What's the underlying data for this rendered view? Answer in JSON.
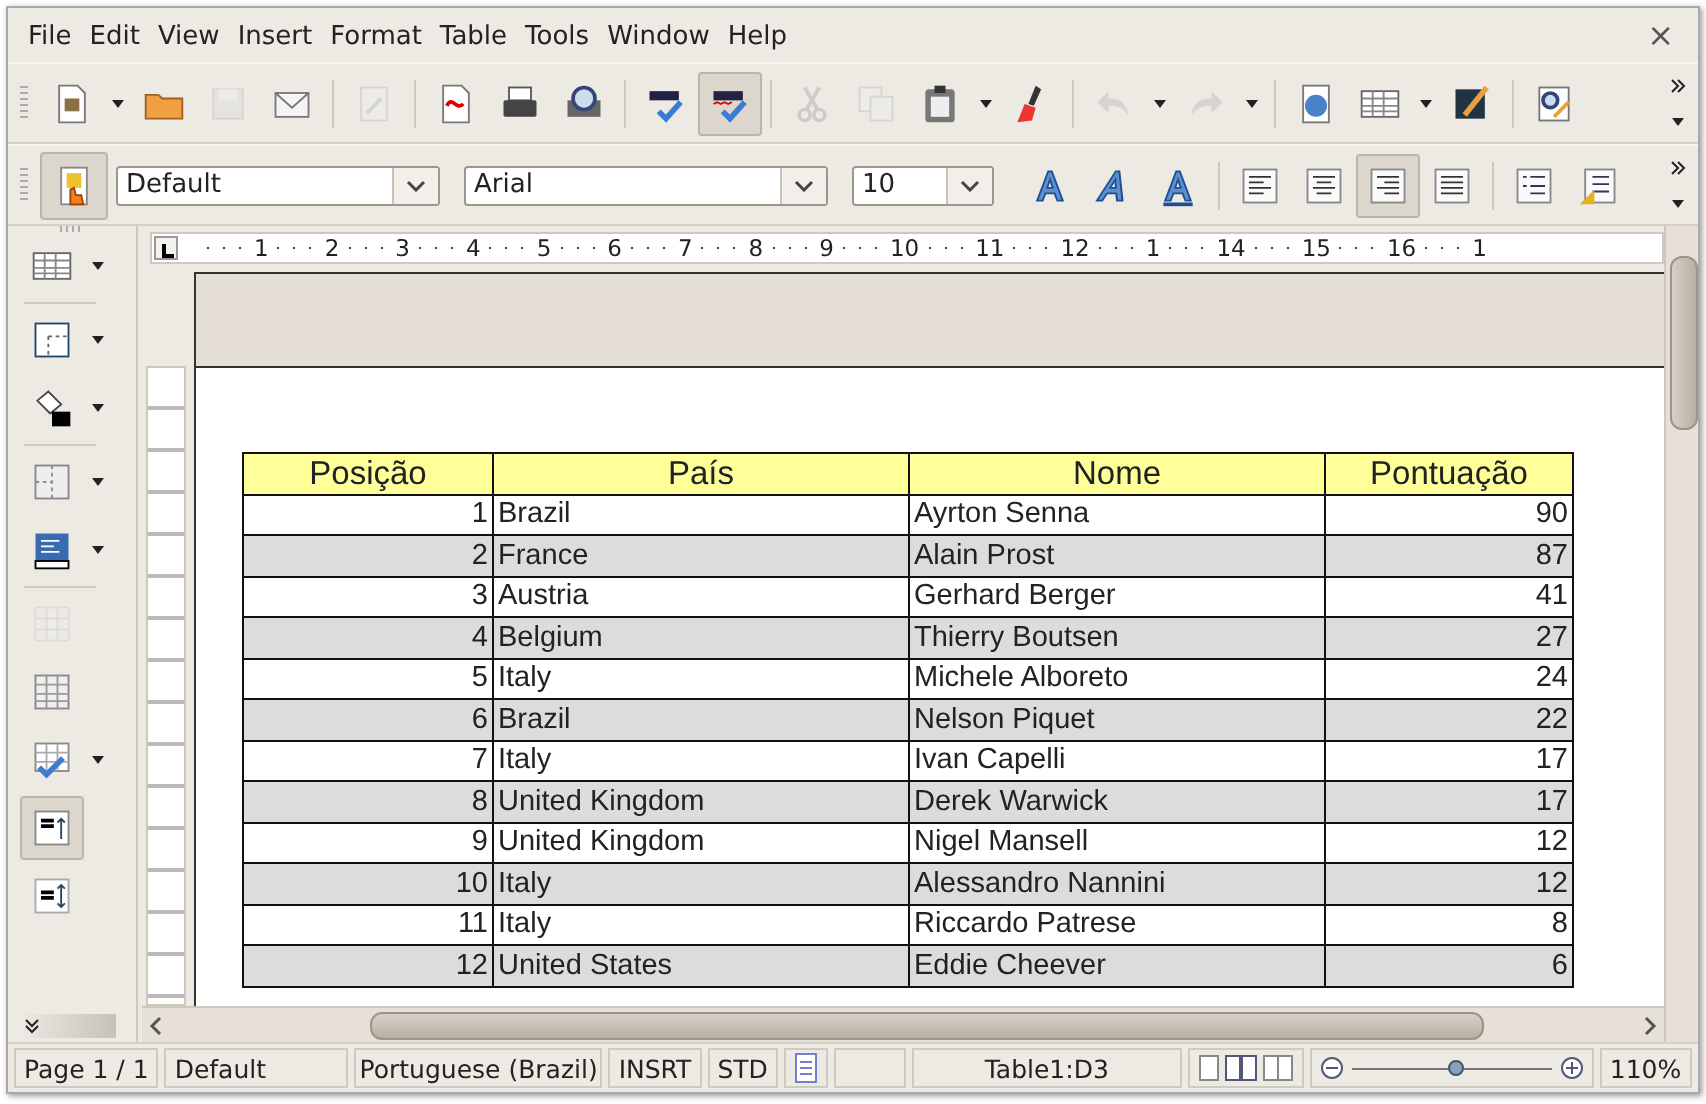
{
  "menu": [
    {
      "label": "File"
    },
    {
      "label": "Edit"
    },
    {
      "label": "View"
    },
    {
      "label": "Insert"
    },
    {
      "label": "Format"
    },
    {
      "label": "Table"
    },
    {
      "label": "Tools"
    },
    {
      "label": "Window"
    },
    {
      "label": "Help"
    }
  ],
  "close_button": {
    "label": "×"
  },
  "standard_toolbar": [
    {
      "kind": "new",
      "dropdown": true,
      "disabled": false,
      "on": false
    },
    {
      "kind": "open",
      "dropdown": false,
      "disabled": false,
      "on": false
    },
    {
      "kind": "save",
      "dropdown": false,
      "disabled": true,
      "on": false
    },
    {
      "kind": "email",
      "dropdown": false,
      "disabled": false,
      "on": false
    },
    {
      "kind": "separator"
    },
    {
      "kind": "edit",
      "dropdown": false,
      "disabled": true,
      "on": false
    },
    {
      "kind": "separator"
    },
    {
      "kind": "pdf",
      "dropdown": false,
      "disabled": false,
      "on": false
    },
    {
      "kind": "print",
      "dropdown": false,
      "disabled": false,
      "on": false
    },
    {
      "kind": "preview",
      "dropdown": false,
      "disabled": false,
      "on": false
    },
    {
      "kind": "separator"
    },
    {
      "kind": "spell",
      "dropdown": false,
      "disabled": false,
      "on": false
    },
    {
      "kind": "autospell",
      "dropdown": false,
      "disabled": false,
      "on": true
    },
    {
      "kind": "separator"
    },
    {
      "kind": "cut",
      "dropdown": false,
      "disabled": true,
      "on": false
    },
    {
      "kind": "copy",
      "dropdown": false,
      "disabled": true,
      "on": false
    },
    {
      "kind": "paste",
      "dropdown": true,
      "disabled": false,
      "on": false
    },
    {
      "kind": "brush",
      "dropdown": false,
      "disabled": false,
      "on": false
    },
    {
      "kind": "separator"
    },
    {
      "kind": "undo",
      "dropdown": true,
      "disabled": true,
      "on": false
    },
    {
      "kind": "redo",
      "dropdown": true,
      "disabled": true,
      "on": false
    },
    {
      "kind": "separator"
    },
    {
      "kind": "navigator",
      "dropdown": false,
      "disabled": false,
      "on": false
    },
    {
      "kind": "table",
      "dropdown": true,
      "disabled": false,
      "on": false
    },
    {
      "kind": "draw",
      "dropdown": false,
      "disabled": false,
      "on": false
    },
    {
      "kind": "separator"
    },
    {
      "kind": "find",
      "dropdown": false,
      "disabled": false,
      "on": false
    }
  ],
  "formatting_toolbar": {
    "stylist_on": true,
    "paragraph_style": {
      "value": "Default"
    },
    "font_name": {
      "value": "Arial"
    },
    "font_size": {
      "value": "10"
    },
    "text_buttons": [
      {
        "kind": "bold"
      },
      {
        "kind": "italic"
      },
      {
        "kind": "underline"
      }
    ],
    "alignment": [
      {
        "kind": "left",
        "selected": false
      },
      {
        "kind": "center",
        "selected": false
      },
      {
        "kind": "right",
        "selected": true
      },
      {
        "kind": "justify",
        "selected": false
      }
    ],
    "list_buttons": [
      {
        "kind": "numbering"
      },
      {
        "kind": "bullets"
      }
    ]
  },
  "table_toolbar": [
    {
      "kind": "table",
      "dropdown": true,
      "disabled": false,
      "on": false
    },
    {
      "kind": "separator"
    },
    {
      "kind": "borders",
      "dropdown": true,
      "disabled": false,
      "on": false
    },
    {
      "kind": "background",
      "dropdown": true,
      "disabled": false,
      "on": false
    },
    {
      "kind": "separator"
    },
    {
      "kind": "merge",
      "dropdown": true,
      "disabled": false,
      "on": false
    },
    {
      "kind": "optimize",
      "dropdown": true,
      "disabled": false,
      "on": false
    },
    {
      "kind": "separator"
    },
    {
      "kind": "split",
      "dropdown": false,
      "disabled": true,
      "on": false
    },
    {
      "kind": "grid",
      "dropdown": false,
      "disabled": false,
      "on": false
    },
    {
      "kind": "autoformat",
      "dropdown": true,
      "disabled": false,
      "on": false
    },
    {
      "kind": "top",
      "dropdown": false,
      "disabled": false,
      "on": true
    },
    {
      "kind": "center_v",
      "dropdown": false,
      "disabled": false,
      "on": false
    }
  ],
  "ruler": {
    "labels": [
      "1",
      "2",
      "3",
      "4",
      "5",
      "6",
      "7",
      "8",
      "9",
      "10",
      "11",
      "12",
      "1",
      "14",
      "15",
      "16",
      "1"
    ]
  },
  "table": {
    "columns": [
      "Posição",
      "País",
      "Nome",
      "Pontuação"
    ],
    "rows": [
      [
        "1",
        "Brazil",
        "Ayrton Senna",
        "90"
      ],
      [
        "2",
        "France",
        "Alain Prost",
        "87"
      ],
      [
        "3",
        "Austria",
        "Gerhard Berger",
        "41"
      ],
      [
        "4",
        "Belgium",
        "Thierry Boutsen",
        "27"
      ],
      [
        "5",
        "Italy",
        "Michele Alboreto",
        "24"
      ],
      [
        "6",
        "Brazil",
        "Nelson Piquet",
        "22"
      ],
      [
        "7",
        "Italy",
        "Ivan Capelli",
        "17"
      ],
      [
        "8",
        "United Kingdom",
        "Derek Warwick",
        "17"
      ],
      [
        "9",
        "United Kingdom",
        "Nigel Mansell",
        "12"
      ],
      [
        "10",
        "Italy",
        "Alessandro Nannini",
        "12"
      ],
      [
        "11",
        "Italy",
        "Riccardo Patrese",
        "8"
      ],
      [
        "12",
        "United States",
        "Eddie Cheever",
        "6"
      ]
    ]
  },
  "status_bar": {
    "page": "Page 1 / 1",
    "page_style": "Default",
    "language": "Portuguese (Brazil)",
    "insert_mode": "INSRT",
    "selection_mode": "STD",
    "cell": "Table1:D3",
    "zoom": {
      "level": 0.52
    },
    "zoom_percent": "110%"
  }
}
